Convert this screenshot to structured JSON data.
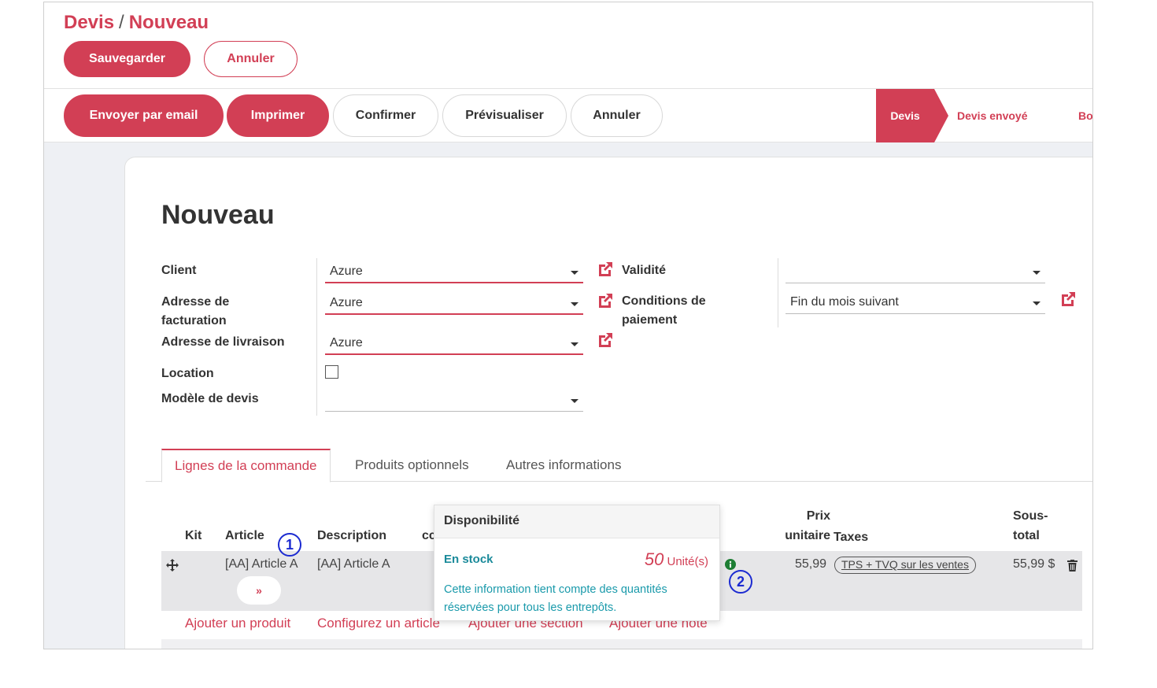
{
  "breadcrumb": {
    "parent": "Devis",
    "separator": "/",
    "current": "Nouveau"
  },
  "control_panel": {
    "save_label": "Sauvegarder",
    "discard_label": "Annuler"
  },
  "statusbar": {
    "buttons": [
      "Envoyer par email",
      "Imprimer",
      "Confirmer",
      "Prévisualiser",
      "Annuler"
    ],
    "stages": [
      "Devis",
      "Devis envoyé",
      "Bo"
    ],
    "active_stage": "Devis"
  },
  "form": {
    "title": "Nouveau",
    "client_label": "Client",
    "client_value": "Azure",
    "invoice_address_label": "Adresse de facturation",
    "invoice_address_value": "Azure",
    "delivery_address_label": "Adresse de livraison",
    "delivery_address_value": "Azure",
    "location_label": "Location",
    "template_label": "Modèle de devis",
    "template_value": "",
    "validity_label": "Validité",
    "validity_value": "",
    "payment_terms_label": "Conditions de paiement",
    "payment_terms_value": "Fin du mois suivant"
  },
  "tabs": [
    "Lignes de la commande",
    "Produits optionnels",
    "Autres informations"
  ],
  "lines_table": {
    "columns": {
      "kit": "Kit",
      "article": "Article",
      "description": "Description",
      "truncated": "cc",
      "unit_price": "Prix unitaire",
      "taxes": "Taxes",
      "subtotal": "Sous-total"
    },
    "rows": [
      {
        "article": "[AA] Article A",
        "description": "[AA] Article A",
        "unit_price": "55,99",
        "taxes": "TPS + TVQ sur les ventes",
        "subtotal": "55,99 $"
      }
    ],
    "actions": [
      "Ajouter un produit",
      "Configurez un article",
      "Ajouter une section",
      "Ajouter une note"
    ]
  },
  "popover": {
    "title": "Disponibilité",
    "status": "En stock",
    "quantity": "50",
    "unit": "Unité(s)",
    "info": "Cette information tient compte des quantités réservées pour tous les entrepôts."
  },
  "callouts": [
    "1",
    "2"
  ],
  "colors": {
    "brand": "#d23f55",
    "teal": "#1a9aab",
    "callout": "#1c2bd1"
  },
  "icons": {
    "external_link": "external-link-icon",
    "drag": "drag-handle-icon",
    "trash": "trash-icon",
    "info": "info-icon",
    "pill_arrow": "»"
  }
}
